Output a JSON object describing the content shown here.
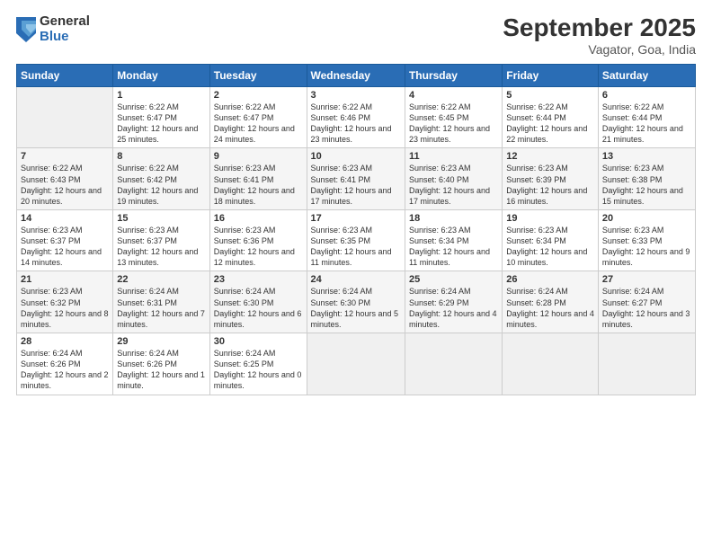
{
  "logo": {
    "general": "General",
    "blue": "Blue"
  },
  "header": {
    "month": "September 2025",
    "location": "Vagator, Goa, India"
  },
  "weekdays": [
    "Sunday",
    "Monday",
    "Tuesday",
    "Wednesday",
    "Thursday",
    "Friday",
    "Saturday"
  ],
  "weeks": [
    [
      {
        "day": "",
        "sunrise": "",
        "sunset": "",
        "daylight": ""
      },
      {
        "day": "1",
        "sunrise": "Sunrise: 6:22 AM",
        "sunset": "Sunset: 6:47 PM",
        "daylight": "Daylight: 12 hours and 25 minutes."
      },
      {
        "day": "2",
        "sunrise": "Sunrise: 6:22 AM",
        "sunset": "Sunset: 6:47 PM",
        "daylight": "Daylight: 12 hours and 24 minutes."
      },
      {
        "day": "3",
        "sunrise": "Sunrise: 6:22 AM",
        "sunset": "Sunset: 6:46 PM",
        "daylight": "Daylight: 12 hours and 23 minutes."
      },
      {
        "day": "4",
        "sunrise": "Sunrise: 6:22 AM",
        "sunset": "Sunset: 6:45 PM",
        "daylight": "Daylight: 12 hours and 23 minutes."
      },
      {
        "day": "5",
        "sunrise": "Sunrise: 6:22 AM",
        "sunset": "Sunset: 6:44 PM",
        "daylight": "Daylight: 12 hours and 22 minutes."
      },
      {
        "day": "6",
        "sunrise": "Sunrise: 6:22 AM",
        "sunset": "Sunset: 6:44 PM",
        "daylight": "Daylight: 12 hours and 21 minutes."
      }
    ],
    [
      {
        "day": "7",
        "sunrise": "Sunrise: 6:22 AM",
        "sunset": "Sunset: 6:43 PM",
        "daylight": "Daylight: 12 hours and 20 minutes."
      },
      {
        "day": "8",
        "sunrise": "Sunrise: 6:22 AM",
        "sunset": "Sunset: 6:42 PM",
        "daylight": "Daylight: 12 hours and 19 minutes."
      },
      {
        "day": "9",
        "sunrise": "Sunrise: 6:23 AM",
        "sunset": "Sunset: 6:41 PM",
        "daylight": "Daylight: 12 hours and 18 minutes."
      },
      {
        "day": "10",
        "sunrise": "Sunrise: 6:23 AM",
        "sunset": "Sunset: 6:41 PM",
        "daylight": "Daylight: 12 hours and 17 minutes."
      },
      {
        "day": "11",
        "sunrise": "Sunrise: 6:23 AM",
        "sunset": "Sunset: 6:40 PM",
        "daylight": "Daylight: 12 hours and 17 minutes."
      },
      {
        "day": "12",
        "sunrise": "Sunrise: 6:23 AM",
        "sunset": "Sunset: 6:39 PM",
        "daylight": "Daylight: 12 hours and 16 minutes."
      },
      {
        "day": "13",
        "sunrise": "Sunrise: 6:23 AM",
        "sunset": "Sunset: 6:38 PM",
        "daylight": "Daylight: 12 hours and 15 minutes."
      }
    ],
    [
      {
        "day": "14",
        "sunrise": "Sunrise: 6:23 AM",
        "sunset": "Sunset: 6:37 PM",
        "daylight": "Daylight: 12 hours and 14 minutes."
      },
      {
        "day": "15",
        "sunrise": "Sunrise: 6:23 AM",
        "sunset": "Sunset: 6:37 PM",
        "daylight": "Daylight: 12 hours and 13 minutes."
      },
      {
        "day": "16",
        "sunrise": "Sunrise: 6:23 AM",
        "sunset": "Sunset: 6:36 PM",
        "daylight": "Daylight: 12 hours and 12 minutes."
      },
      {
        "day": "17",
        "sunrise": "Sunrise: 6:23 AM",
        "sunset": "Sunset: 6:35 PM",
        "daylight": "Daylight: 12 hours and 11 minutes."
      },
      {
        "day": "18",
        "sunrise": "Sunrise: 6:23 AM",
        "sunset": "Sunset: 6:34 PM",
        "daylight": "Daylight: 12 hours and 11 minutes."
      },
      {
        "day": "19",
        "sunrise": "Sunrise: 6:23 AM",
        "sunset": "Sunset: 6:34 PM",
        "daylight": "Daylight: 12 hours and 10 minutes."
      },
      {
        "day": "20",
        "sunrise": "Sunrise: 6:23 AM",
        "sunset": "Sunset: 6:33 PM",
        "daylight": "Daylight: 12 hours and 9 minutes."
      }
    ],
    [
      {
        "day": "21",
        "sunrise": "Sunrise: 6:23 AM",
        "sunset": "Sunset: 6:32 PM",
        "daylight": "Daylight: 12 hours and 8 minutes."
      },
      {
        "day": "22",
        "sunrise": "Sunrise: 6:24 AM",
        "sunset": "Sunset: 6:31 PM",
        "daylight": "Daylight: 12 hours and 7 minutes."
      },
      {
        "day": "23",
        "sunrise": "Sunrise: 6:24 AM",
        "sunset": "Sunset: 6:30 PM",
        "daylight": "Daylight: 12 hours and 6 minutes."
      },
      {
        "day": "24",
        "sunrise": "Sunrise: 6:24 AM",
        "sunset": "Sunset: 6:30 PM",
        "daylight": "Daylight: 12 hours and 5 minutes."
      },
      {
        "day": "25",
        "sunrise": "Sunrise: 6:24 AM",
        "sunset": "Sunset: 6:29 PM",
        "daylight": "Daylight: 12 hours and 4 minutes."
      },
      {
        "day": "26",
        "sunrise": "Sunrise: 6:24 AM",
        "sunset": "Sunset: 6:28 PM",
        "daylight": "Daylight: 12 hours and 4 minutes."
      },
      {
        "day": "27",
        "sunrise": "Sunrise: 6:24 AM",
        "sunset": "Sunset: 6:27 PM",
        "daylight": "Daylight: 12 hours and 3 minutes."
      }
    ],
    [
      {
        "day": "28",
        "sunrise": "Sunrise: 6:24 AM",
        "sunset": "Sunset: 6:26 PM",
        "daylight": "Daylight: 12 hours and 2 minutes."
      },
      {
        "day": "29",
        "sunrise": "Sunrise: 6:24 AM",
        "sunset": "Sunset: 6:26 PM",
        "daylight": "Daylight: 12 hours and 1 minute."
      },
      {
        "day": "30",
        "sunrise": "Sunrise: 6:24 AM",
        "sunset": "Sunset: 6:25 PM",
        "daylight": "Daylight: 12 hours and 0 minutes."
      },
      {
        "day": "",
        "sunrise": "",
        "sunset": "",
        "daylight": ""
      },
      {
        "day": "",
        "sunrise": "",
        "sunset": "",
        "daylight": ""
      },
      {
        "day": "",
        "sunrise": "",
        "sunset": "",
        "daylight": ""
      },
      {
        "day": "",
        "sunrise": "",
        "sunset": "",
        "daylight": ""
      }
    ]
  ]
}
